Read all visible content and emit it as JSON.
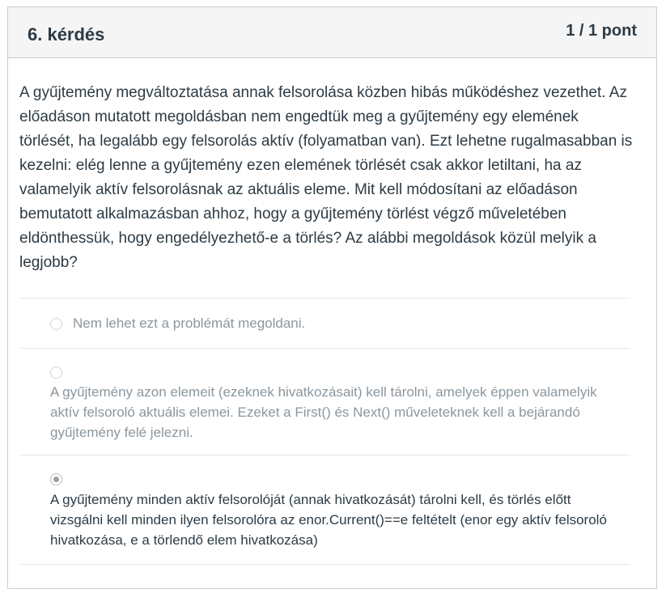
{
  "question": {
    "title": "6. kérdés",
    "points": "1 / 1 pont",
    "text": "A gyűjtemény megváltoztatása annak felsorolása közben hibás működéshez vezethet. Az előadáson mutatott megoldásban nem engedtük meg a gyűjtemény egy elemének törlését, ha legalább egy felsorolás aktív (folyamatban van). Ezt lehetne rugalmasabban is kezelni: elég lenne a gyűjtemény ezen elemének törlését csak akkor letiltani, ha az valamelyik aktív  felsorolásnak az aktuális eleme. Mit kell módosítani az előadáson bemutatott alkalmazásban ahhoz, hogy a gyűjtemény törlést végző műveletében eldönthessük, hogy engedélyezhető-e a törlés? Az alábbi megoldások közül melyik a legjobb?"
  },
  "answers": [
    {
      "text": "Nem lehet ezt a problémát megoldani.",
      "selected": false
    },
    {
      "text": "A gyűjtemény azon elemeit (ezeknek hivatkozásait) kell tárolni, amelyek éppen valamelyik aktív felsoroló aktuális elemei. Ezeket a First() és Next() műveleteknek kell a bejárandó gyűjtemény felé jelezni.",
      "selected": false
    },
    {
      "text": "A gyűjtemény minden aktív felsorolóját (annak hivatkozását) tárolni kell, és törlés előtt vizsgálni kell minden ilyen felsorolóra az enor.Current()==e feltételt (enor egy aktív felsoroló hivatkozása, e a törlendő elem hivatkozása)",
      "selected": true
    }
  ]
}
